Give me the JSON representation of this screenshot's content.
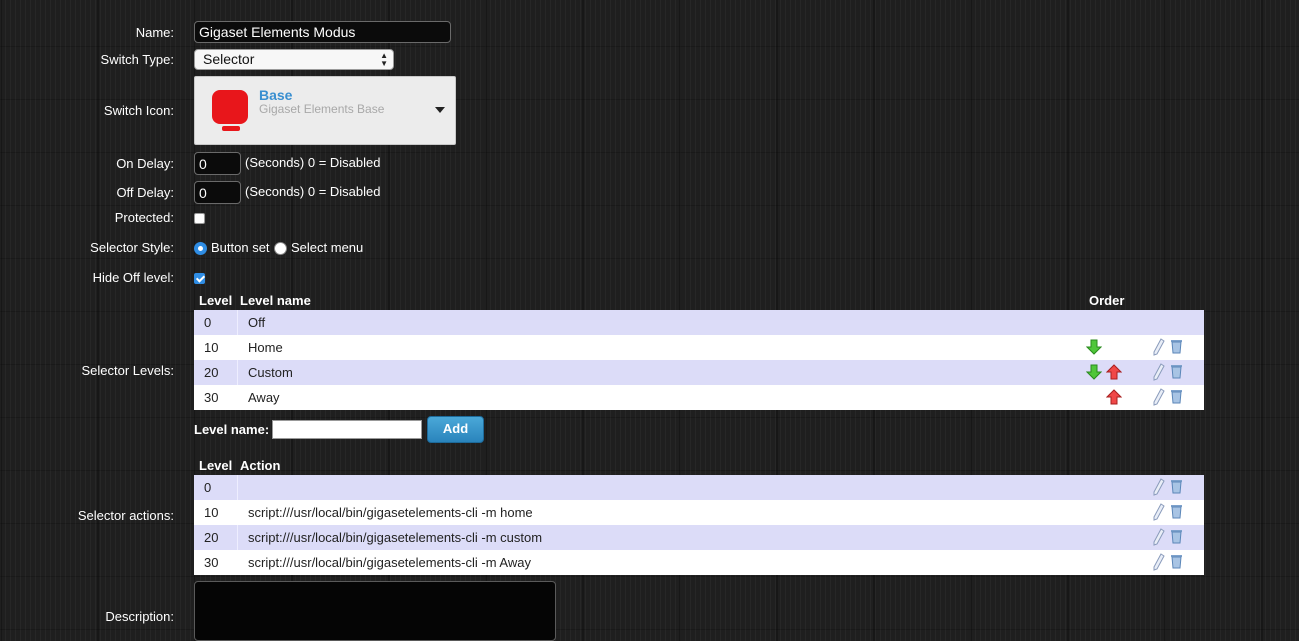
{
  "form": {
    "name_label": "Name:",
    "name_value": "Gigaset Elements Modus",
    "switch_type_label": "Switch Type:",
    "switch_type_value": "Selector",
    "switch_icon_label": "Switch Icon:",
    "icon_title": "Base",
    "icon_subtitle": "Gigaset Elements Base",
    "on_delay_label": "On Delay:",
    "on_delay_value": "0",
    "on_delay_hint": "(Seconds) 0 = Disabled",
    "off_delay_label": "Off Delay:",
    "off_delay_value": "0",
    "off_delay_hint": "(Seconds) 0 = Disabled",
    "protected_label": "Protected:",
    "selector_style_label": "Selector Style:",
    "style_option_buttons": "Button set",
    "style_option_menu": "Select menu",
    "hide_off_label": "Hide Off level:",
    "selector_levels_label": "Selector Levels:",
    "selector_actions_label": "Selector actions:",
    "description_label": "Description:"
  },
  "levels": {
    "headers": {
      "level": "Level",
      "name": "Level name",
      "order": "Order"
    },
    "rows": [
      {
        "level": "0",
        "name": "Off"
      },
      {
        "level": "10",
        "name": "Home"
      },
      {
        "level": "20",
        "name": "Custom"
      },
      {
        "level": "30",
        "name": "Away"
      }
    ],
    "level_name_label": "Level name:",
    "add_label": "Add"
  },
  "actions": {
    "headers": {
      "level": "Level",
      "action": "Action"
    },
    "rows": [
      {
        "level": "0",
        "action": ""
      },
      {
        "level": "10",
        "action": "script:///usr/local/bin/gigasetelements-cli -m home"
      },
      {
        "level": "20",
        "action": "script:///usr/local/bin/gigasetelements-cli -m custom"
      },
      {
        "level": "30",
        "action": "script:///usr/local/bin/gigasetelements-cli -m Away"
      }
    ]
  },
  "state": {
    "protected": false,
    "selector_style": "Button set",
    "hide_off_level": true
  },
  "colors": {
    "accent": "#2f8de4",
    "icon_red": "#e8161b",
    "table_odd_row": "#dcdcf8"
  },
  "icons": [
    "arrow-down-icon",
    "arrow-up-icon",
    "edit-icon",
    "trash-icon",
    "dropdown-caret-icon"
  ]
}
